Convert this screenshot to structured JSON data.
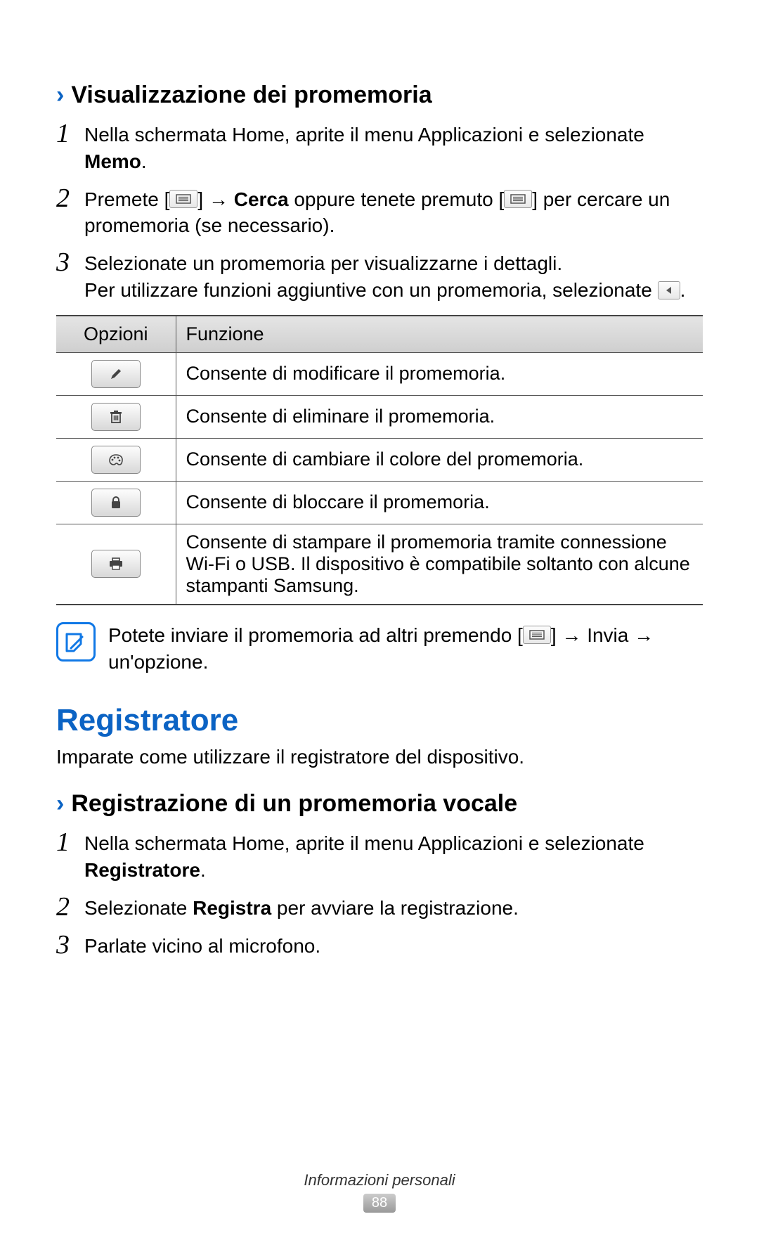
{
  "section1": {
    "heading": "Visualizzazione dei promemoria",
    "steps": [
      {
        "num": "1",
        "text_a": "Nella schermata Home, aprite il menu Applicazioni e selezionate ",
        "bold_a": "Memo",
        "text_b": "."
      },
      {
        "num": "2",
        "text_a": "Premete [",
        "text_b": "] → ",
        "bold_a": "Cerca",
        "text_c": " oppure tenete premuto [",
        "text_d": "] per cercare un promemoria (se necessario)."
      },
      {
        "num": "3",
        "line1": "Selezionate un promemoria per visualizzarne i dettagli.",
        "line2_a": "Per utilizzare funzioni aggiuntive con un promemoria, selezionate ",
        "line2_b": "."
      }
    ],
    "table": {
      "head_col1": "Opzioni",
      "head_col2": "Funzione",
      "rows": [
        {
          "icon": "pencil",
          "text": "Consente di modificare il promemoria."
        },
        {
          "icon": "trash",
          "text": "Consente di eliminare il promemoria."
        },
        {
          "icon": "palette",
          "text": "Consente di cambiare il colore del promemoria."
        },
        {
          "icon": "lock",
          "text": "Consente di bloccare il promemoria."
        },
        {
          "icon": "printer",
          "text": "Consente di stampare il promemoria tramite connessione Wi-Fi o USB. Il dispositivo è compatibile soltanto con alcune stampanti Samsung."
        }
      ]
    },
    "note": {
      "text_a": "Potete inviare il promemoria ad altri premendo [",
      "text_b": "] → ",
      "bold_a": "Invia",
      "text_c": " → un'opzione."
    }
  },
  "section2": {
    "heading": "Registratore",
    "intro": "Imparate come utilizzare il registratore del dispositivo.",
    "sub_heading": "Registrazione di un promemoria vocale",
    "steps": [
      {
        "num": "1",
        "text_a": "Nella schermata Home, aprite il menu Applicazioni e selezionate ",
        "bold_a": "Registratore",
        "text_b": "."
      },
      {
        "num": "2",
        "text_a": "Selezionate ",
        "bold_a": "Registra",
        "text_b": " per avviare la registrazione."
      },
      {
        "num": "3",
        "text_a": "Parlate vicino al microfono."
      }
    ]
  },
  "footer": {
    "category": "Informazioni personali",
    "page": "88"
  }
}
